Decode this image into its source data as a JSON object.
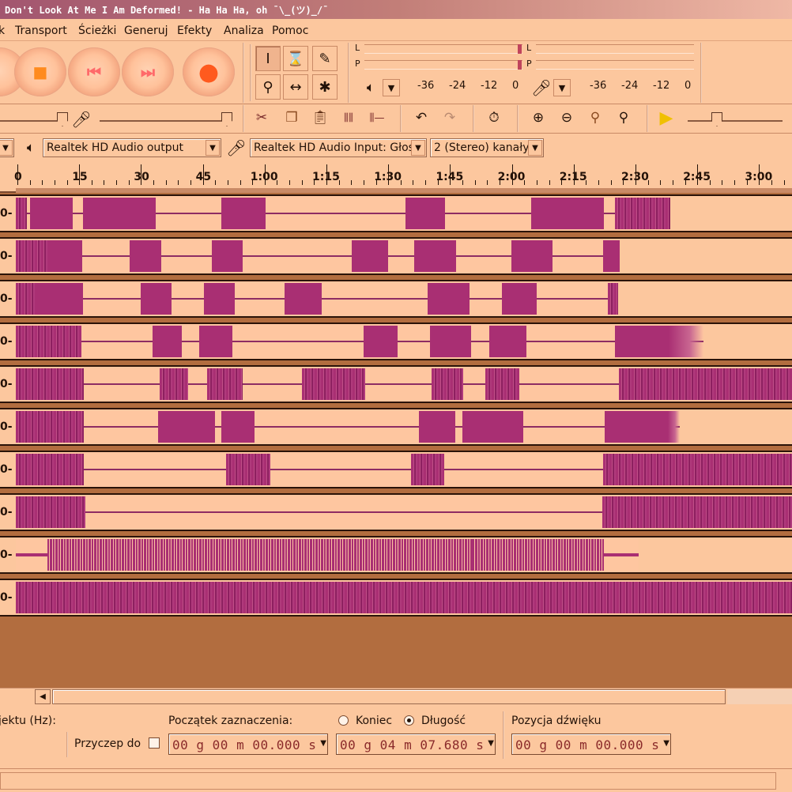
{
  "window": {
    "title": "Don't Look At Me I Am Deformed! - Ha Ha Ha, oh ¯\\_(ツ)_/¯"
  },
  "menu": {
    "items": [
      {
        "label": "k"
      },
      {
        "label": "Transport"
      },
      {
        "label": "Ścieżki"
      },
      {
        "label": "Generuj"
      },
      {
        "label": "Efekty"
      },
      {
        "label": "Analiza"
      },
      {
        "label": "Pomoc"
      }
    ]
  },
  "transport": {
    "buttons": [
      {
        "name": "pause",
        "glyph": ""
      },
      {
        "name": "stop",
        "glyph": "■"
      },
      {
        "name": "skip-start",
        "glyph": "⏮"
      },
      {
        "name": "skip-end",
        "glyph": "⏭"
      },
      {
        "name": "record",
        "glyph": "●"
      }
    ]
  },
  "tools": {
    "selection": "I",
    "envelope": "⌛",
    "draw": "✎",
    "zoom": "⚲",
    "timeshift": "↔",
    "multi": "✱"
  },
  "meters": {
    "output": {
      "left": "L",
      "right": "P",
      "scale": [
        "-36",
        "-24",
        "-12",
        "0"
      ]
    },
    "input": {
      "left": "L",
      "right": "P",
      "scale": [
        "-36",
        "-24",
        "-12",
        "0"
      ]
    }
  },
  "devices": {
    "host": "",
    "output": "Realtek HD Audio output",
    "input": "Realtek HD Audio Input: Głośn",
    "channels": "2 (Stereo) kanały"
  },
  "edit_toolbar": {
    "buttons": [
      "cut",
      "copy",
      "paste",
      "trim",
      "silence",
      "undo",
      "redo",
      "sync-lock",
      "zoom-in",
      "zoom-out",
      "fit-selection",
      "fit-project",
      "play-at-speed"
    ]
  },
  "ruler": {
    "labels": [
      "0",
      "15",
      "30",
      "45",
      "1:00",
      "1:15",
      "1:30",
      "1:45",
      "2:00",
      "2:15",
      "2:30",
      "2:45",
      "3:00"
    ]
  },
  "tracks": [
    {
      "label": "0-"
    },
    {
      "label": "0-"
    },
    {
      "label": "0-"
    },
    {
      "label": "0-"
    },
    {
      "label": "0-"
    },
    {
      "label": "0-"
    },
    {
      "label": "0-"
    },
    {
      "label": "0-"
    },
    {
      "label": "0-"
    },
    {
      "label": "0-"
    }
  ],
  "selection": {
    "project_rate_label": "jektu (Hz):",
    "start_label": "Początek zaznaczenia:",
    "end_label": "Koniec",
    "length_label": "Długość",
    "length_selected": true,
    "position_label": "Pozycja dźwięku",
    "snap_label": "Przyczep do",
    "start_value": "00 g 00 m 00.000 s",
    "length_value": "00 g 04 m 07.680 s",
    "position_value": "00 g 00 m 00.000 s"
  },
  "colors": {
    "background": "#fcc79e",
    "waveform": "#a92f73",
    "accent": "#ff8b1e"
  }
}
